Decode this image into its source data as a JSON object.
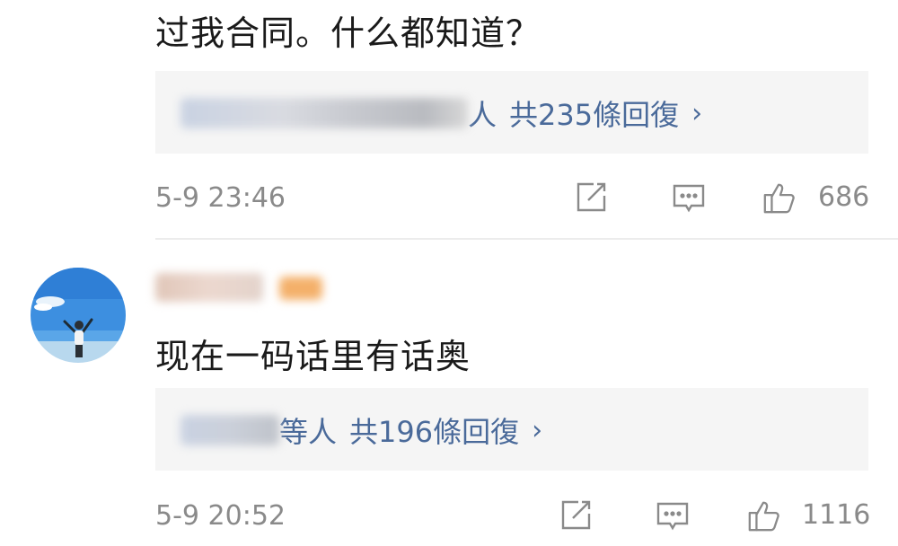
{
  "comments": [
    {
      "text": "过我合同。什么都知道？",
      "reply_names_suffix": "人",
      "reply_count": "共235條回復",
      "reply_chevron": "›",
      "timestamp": "5-9 23:46",
      "like_count": "686"
    },
    {
      "text": "现在一码话里有话奥",
      "reply_names_suffix": "等人",
      "reply_count": "共196條回復",
      "reply_chevron": "›",
      "timestamp": "5-9 20:52",
      "like_count": "1116"
    }
  ],
  "icons": {
    "share": "share-icon",
    "comment": "comment-icon",
    "like": "thumbs-up-icon"
  },
  "colors": {
    "link": "#4a6a9a",
    "meta_text": "#8a8a8a",
    "reply_bg": "#f5f5f5",
    "divider": "#ececec"
  }
}
